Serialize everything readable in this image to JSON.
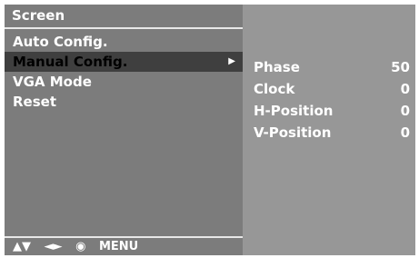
{
  "menu": {
    "title": "Screen",
    "items": [
      {
        "label": "Auto Config."
      },
      {
        "label": "Manual Config.",
        "selected": true
      },
      {
        "label": "VGA Mode"
      },
      {
        "label": "Reset"
      }
    ]
  },
  "nav": {
    "updown": "▲▼",
    "leftright": "◄►",
    "ok": "◉",
    "menu": "MENU"
  },
  "submenu": {
    "params": [
      {
        "label": "Phase",
        "value": "50"
      },
      {
        "label": "Clock",
        "value": "0"
      },
      {
        "label": "H-Position",
        "value": "0"
      },
      {
        "label": "V-Position",
        "value": "0"
      }
    ]
  },
  "colors": {
    "left_panel": "#7c7c7c",
    "right_panel": "#979797",
    "highlight": "#3f3f3f",
    "text": "#ffffff"
  },
  "icons": [
    "updown-arrows-icon",
    "leftright-arrows-icon",
    "ok-circle-icon",
    "right-arrow-icon"
  ]
}
